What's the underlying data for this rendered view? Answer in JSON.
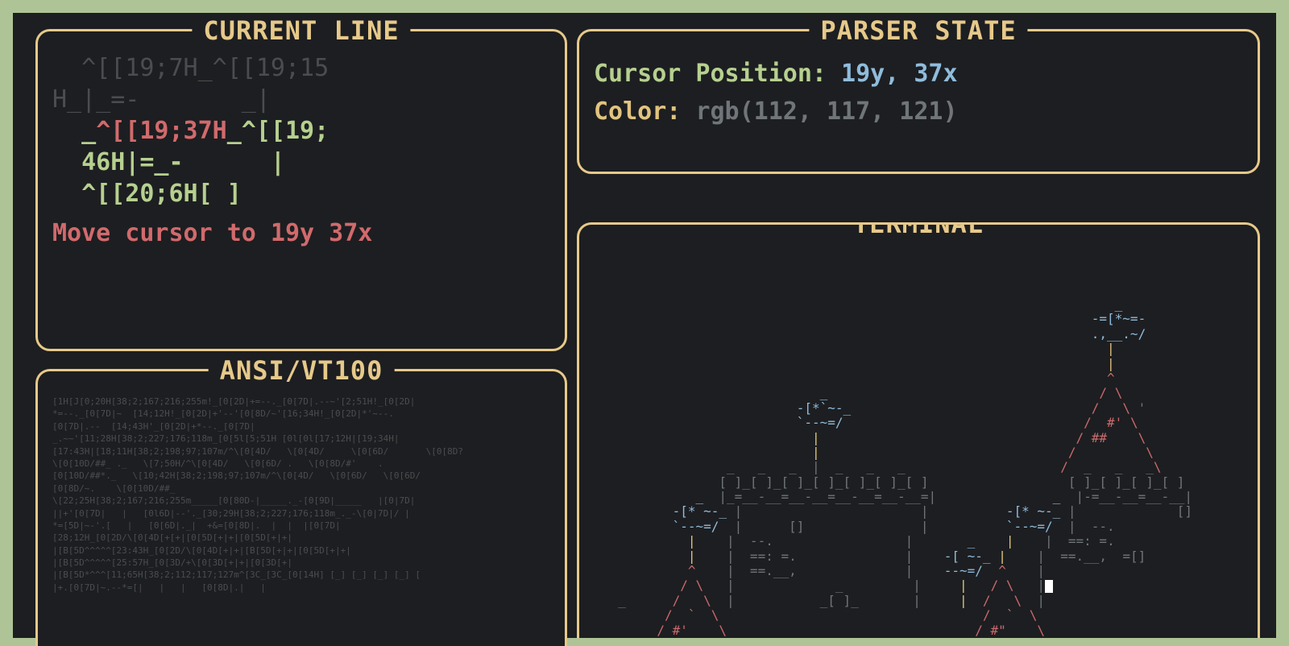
{
  "panels": {
    "current_line": {
      "title": "CURRENT LINE",
      "faded_prefix_line1": "  ^[[19;7H_^[[19;15",
      "faded_prefix_line2": "H_|_=-       _|",
      "hl_pre": "  _",
      "hl_escape": "^[[19;37H",
      "hl_post1": "_^[[19;",
      "hl_post2": "  46H|=_-      |  ",
      "hl_post3": "  ^[[20;6H[ ]     ",
      "message": "Move cursor to 19y 37x"
    },
    "parser_state": {
      "title": "PARSER STATE",
      "cursor_label": "Cursor Position:",
      "cursor_value": "19y, 37x",
      "color_label": "Color:",
      "color_value": "rgb(112, 117, 121)"
    },
    "ansi": {
      "title": "ANSI/VT100",
      "dump": "[1H[J[0;20H[38;2;167;216;255m!_[0[2D|+=--._[0[7D|.--~'[2;51H!_[0[2D|\n*=--._[0[7D|~  [14;12H!_[0[2D|+'--'[0[8D/~'[16;34H!_[0[2D|*'~--.\n[0[7D|.--  [14;43H'_[0[2D|+*--._[0[7D|\n_.~~'[11;28H[38;2;227;176;118m_[0[5l[5;51H [0l[0l[17;12H|[19;34H|\n[17:43H|[18;11H[38;2;198;97;107m/^\\[0[4D/   \\[0[4D/     \\[0[6D/       \\[0[8D?\n\\[0[10D/##_ ._   \\[7;50H/^\\[0[4D/   \\[0[6D/ .   \\[0[8D/#'    .\n[0[10D/##*._   \\[10;42H[38;2;198;97;107m/^\\[0[4D/   \\[0[6D/   \\[0[6D/\n[0[8D/~.    \\[0[10D/##_\n\\[22;25H[38;2;167;216;255m_____[0[80D-|_____._-[0[9D|_____   |[0|7D|\n||+'[0[7D|   |   [0l6D|--'._[30;29H[38;2;227;176;118m_._-\\[0|7D|/ |\n*=[5D|~-'.[   |   [0[6D|._|  +&=[0[8D|.  |  |  |[0[7D|\n[28;12H_[0[2D/\\[0[4D[+[+|[0[5D[+|+|[0[5D[+|+|\n|[B[5D^^^^^[23:43H_[0[2D/\\[0[4D[+|+|[B[5D[+|+|[0[5D[+|+|\n|[B[5D^^^^^[25:57H_[0[3D/+\\[0[3D[+|+|[0[3D[+|\n|[B[5D*^^^[11;65H[38;2;112;117;127m^[3C_[3C_[0[14H] [_] [_] [_] [_] [\n|+.[0[7D|~.--*=[|   |   |   [0[8D|.|   |"
    },
    "terminal": {
      "title": "TERMINAL"
    }
  },
  "castle_ascii": {
    "rows": [
      {
        "segs": [
          {
            "c": "cg",
            "t": "                                                                     "
          },
          {
            "c": "cb",
            "t": "_"
          }
        ]
      },
      {
        "segs": [
          {
            "c": "cg",
            "t": "                                                                  "
          },
          {
            "c": "cb",
            "t": "-=[*~=-"
          }
        ]
      },
      {
        "segs": [
          {
            "c": "cg",
            "t": "                                                                  "
          },
          {
            "c": "cb",
            "t": ".,__.~/"
          }
        ]
      },
      {
        "segs": [
          {
            "c": "cg",
            "t": "                                                                    "
          },
          {
            "c": "cy",
            "t": "|"
          }
        ]
      },
      {
        "segs": [
          {
            "c": "cg",
            "t": "                                                                    "
          },
          {
            "c": "cy",
            "t": "|"
          }
        ]
      },
      {
        "segs": [
          {
            "c": "cg",
            "t": "                                                                    "
          },
          {
            "c": "cr",
            "t": "^"
          }
        ]
      },
      {
        "segs": [
          {
            "c": "cg",
            "t": "                               "
          },
          {
            "c": "cb",
            "t": "_"
          },
          {
            "c": "cg",
            "t": "                                   "
          },
          {
            "c": "cr",
            "t": "/ \\"
          }
        ]
      },
      {
        "segs": [
          {
            "c": "cg",
            "t": "                            "
          },
          {
            "c": "cb",
            "t": "-[*`~-_"
          },
          {
            "c": "cg",
            "t": "                               "
          },
          {
            "c": "cr",
            "t": "/   \\ "
          },
          {
            "c": "cg",
            "t": "'"
          }
        ]
      },
      {
        "segs": [
          {
            "c": "cg",
            "t": "                            "
          },
          {
            "c": "cb",
            "t": "`--~=/"
          },
          {
            "c": "cg",
            "t": "                               "
          },
          {
            "c": "cr",
            "t": "/  #' \\"
          }
        ]
      },
      {
        "segs": [
          {
            "c": "cg",
            "t": "                              "
          },
          {
            "c": "cy",
            "t": "|"
          },
          {
            "c": "cg",
            "t": "                                 "
          },
          {
            "c": "cr",
            "t": "/ ##    \\"
          }
        ]
      },
      {
        "segs": [
          {
            "c": "cg",
            "t": "                              "
          },
          {
            "c": "cy",
            "t": "|"
          },
          {
            "c": "cg",
            "t": "                                "
          },
          {
            "c": "cr",
            "t": "/         \\"
          }
        ]
      },
      {
        "segs": [
          {
            "c": "cg",
            "t": "                   _   _   _  "
          },
          {
            "c": "cg",
            "t": "|"
          },
          {
            "c": "cg",
            "t": "  _   _   _                    "
          },
          {
            "c": "cr",
            "t": "/"
          },
          {
            "c": "cg",
            "t": "  _   _   _"
          },
          {
            "c": "cr",
            "t": "\\"
          }
        ]
      },
      {
        "segs": [
          {
            "c": "cg",
            "t": "                  [ ]_[ ]_[ ]_[ ]_[ ]_[ ]_[ ]                  [ ]_[ ]_[ ]_[ ]"
          }
        ]
      },
      {
        "segs": [
          {
            "c": "cg",
            "t": "               "
          },
          {
            "c": "cb",
            "t": "_"
          },
          {
            "c": "cg",
            "t": "  |_=__-__=__-__=__-__=__-__=|               "
          },
          {
            "c": "cb",
            "t": "_"
          },
          {
            "c": "cg",
            "t": "  |-=__-__=__-__|"
          }
        ]
      },
      {
        "segs": [
          {
            "c": "cg",
            "t": "            "
          },
          {
            "c": "cb",
            "t": "-[* ~-_"
          },
          {
            "c": "cg",
            "t": " |                       |          "
          },
          {
            "c": "cb",
            "t": "-[* ~-_"
          },
          {
            "c": "cg",
            "t": " |             [] "
          }
        ]
      },
      {
        "segs": [
          {
            "c": "cg",
            "t": "            "
          },
          {
            "c": "cb",
            "t": "`--~=/"
          },
          {
            "c": "cg",
            "t": "  |      []               |          "
          },
          {
            "c": "cb",
            "t": "`--~=/"
          },
          {
            "c": "cg",
            "t": "  |  --.          "
          }
        ]
      },
      {
        "segs": [
          {
            "c": "cg",
            "t": "              "
          },
          {
            "c": "cy",
            "t": "|"
          },
          {
            "c": "cg",
            "t": "    |  --.                 |       "
          },
          {
            "c": "cb",
            "t": "_"
          },
          {
            "c": "cg",
            "t": "    "
          },
          {
            "c": "cy",
            "t": "|"
          },
          {
            "c": "cg",
            "t": "    |  ==: =. "
          }
        ]
      },
      {
        "segs": [
          {
            "c": "cg",
            "t": "              "
          },
          {
            "c": "cy",
            "t": "|"
          },
          {
            "c": "cg",
            "t": "    |  ==: =.              |    "
          },
          {
            "c": "cb",
            "t": "-[ ~-_"
          },
          {
            "c": "cg",
            "t": " "
          },
          {
            "c": "cy",
            "t": "|"
          },
          {
            "c": "cg",
            "t": "    |  ==.__,  =[]"
          }
        ]
      },
      {
        "segs": [
          {
            "c": "cg",
            "t": "              "
          },
          {
            "c": "cr",
            "t": "^"
          },
          {
            "c": "cg",
            "t": "    |  ==.__,              |    "
          },
          {
            "c": "cb",
            "t": "--~=/"
          },
          {
            "c": "cg",
            "t": "  "
          },
          {
            "c": "cr",
            "t": "^"
          },
          {
            "c": "cg",
            "t": "    |"
          }
        ]
      },
      {
        "segs": [
          {
            "c": "cg",
            "t": "             "
          },
          {
            "c": "cr",
            "t": "/ \\"
          },
          {
            "c": "cg",
            "t": "   |             _         |     "
          },
          {
            "c": "cy",
            "t": "|"
          },
          {
            "c": "cg",
            "t": "   "
          },
          {
            "c": "cr",
            "t": "/ \\"
          },
          {
            "c": "cg",
            "t": "   |"
          },
          {
            "c": "cursor",
            "t": ""
          }
        ]
      },
      {
        "segs": [
          {
            "c": "cg",
            "t": "     _      "
          },
          {
            "c": "cr",
            "t": "/   \\"
          },
          {
            "c": "cg",
            "t": "  |           _[ ]_       |     "
          },
          {
            "c": "cy",
            "t": "|"
          },
          {
            "c": "cg",
            "t": "  "
          },
          {
            "c": "cr",
            "t": "/   \\"
          },
          {
            "c": "cg",
            "t": "  |"
          }
        ]
      },
      {
        "segs": [
          {
            "c": "cg",
            "t": "           "
          },
          {
            "c": "cr",
            "t": "/  `  \\"
          },
          {
            "c": "cg",
            "t": "                                  "
          },
          {
            "c": "cr",
            "t": "/  `  \\"
          }
        ]
      },
      {
        "segs": [
          {
            "c": "cg",
            "t": "          "
          },
          {
            "c": "cr",
            "t": "/ #'    \\"
          },
          {
            "c": "cg",
            "t": "                                "
          },
          {
            "c": "cr",
            "t": "/ #\"    \\"
          }
        ]
      }
    ]
  }
}
